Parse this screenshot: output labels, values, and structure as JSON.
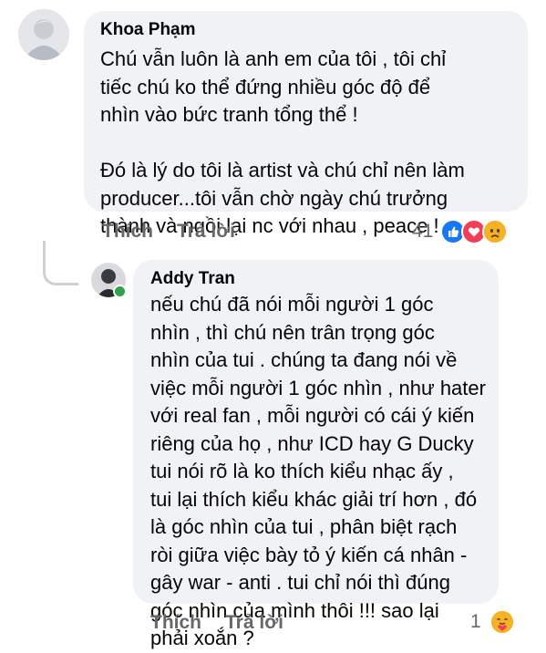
{
  "comment1": {
    "author": "Khoa Phạm",
    "lines": [
      "Chú vẫn luôn là anh em của tôi , tôi chỉ",
      "tiếc chú ko thể đứng nhiều góc độ để",
      "nhìn vào bức tranh tổng thể !",
      "",
      "Đó là lý do tôi là artist và chú chỉ nên làm",
      "producer...tôi vẫn chờ ngày chú trưởng",
      "thành và ngồi lại nc với nhau , peace !"
    ],
    "actions": {
      "like": "Thích",
      "reply": "Trả lời"
    },
    "reaction_count": "41",
    "reaction_icons": [
      "like-icon",
      "love-icon",
      "sad-icon"
    ]
  },
  "comment2": {
    "author": "Addy Tran",
    "lines": [
      "nếu chú đã nói mỗi người 1 góc",
      "nhìn , thì chú nên trân trọng góc",
      "nhìn của  tui . chúng ta đang nói về",
      "việc mỗi người 1 góc nhìn , như hater",
      "với real fan , mỗi người có cái ý kiến",
      "riêng của họ , như ICD hay G Ducky",
      "tui nói rõ là ko thích kiểu nhạc ấy ,",
      "tui lại thích kiểu khác giải trí hơn , đó",
      "là góc nhìn của tui  , phân biệt rạch",
      "ròi giữa việc bày tỏ ý kiến cá nhân -",
      "gây war - anti . tui chỉ nói thì đúng",
      "góc nhìn của mình thôi !!! sao lại",
      "phải xoắn ?"
    ],
    "actions": {
      "like": "Thích",
      "reply": "Trả lời"
    },
    "reaction_count": "1",
    "reaction_icons": [
      "care-icon"
    ],
    "online": true
  },
  "colors": {
    "bubble": "#f0f2f5",
    "secondary_text": "#65676b",
    "like": "#1877f2",
    "love": "#f33e58",
    "sad": "#f7b125",
    "online": "#31a24c"
  }
}
